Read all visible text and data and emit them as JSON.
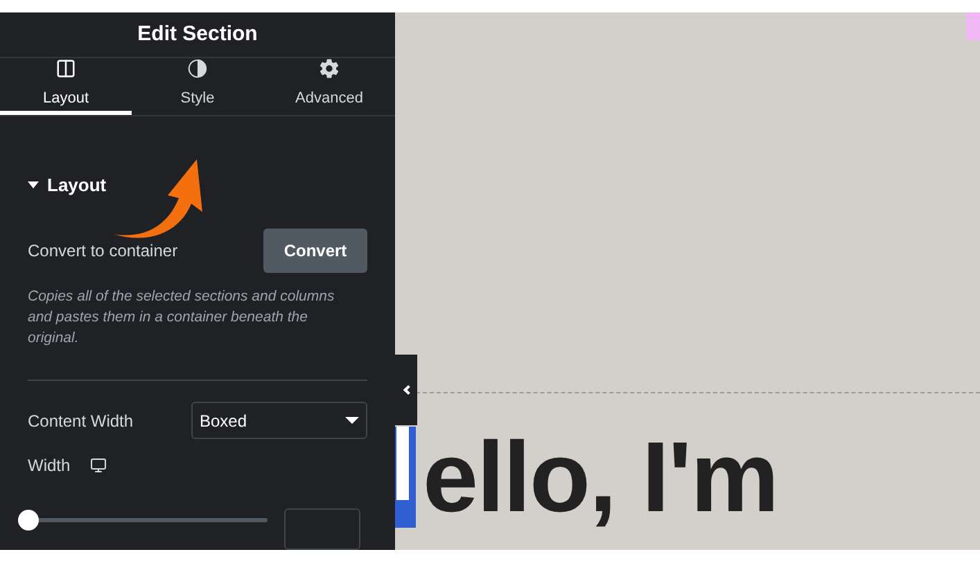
{
  "panel": {
    "title": "Edit Section",
    "tabs": [
      {
        "label": "Layout",
        "selected": true
      },
      {
        "label": "Style",
        "selected": false
      },
      {
        "label": "Advanced",
        "selected": false
      }
    ],
    "section": {
      "title": "Layout",
      "expanded": true
    },
    "convert": {
      "label": "Convert to container",
      "button": "Convert",
      "description": "Copies all of the selected sections and columns and pastes them in a container beneath the original."
    },
    "content_width": {
      "label": "Content Width",
      "value": "Boxed"
    },
    "width": {
      "label": "Width",
      "level": 0
    }
  },
  "canvas": {
    "heading": "ello, I'm"
  }
}
